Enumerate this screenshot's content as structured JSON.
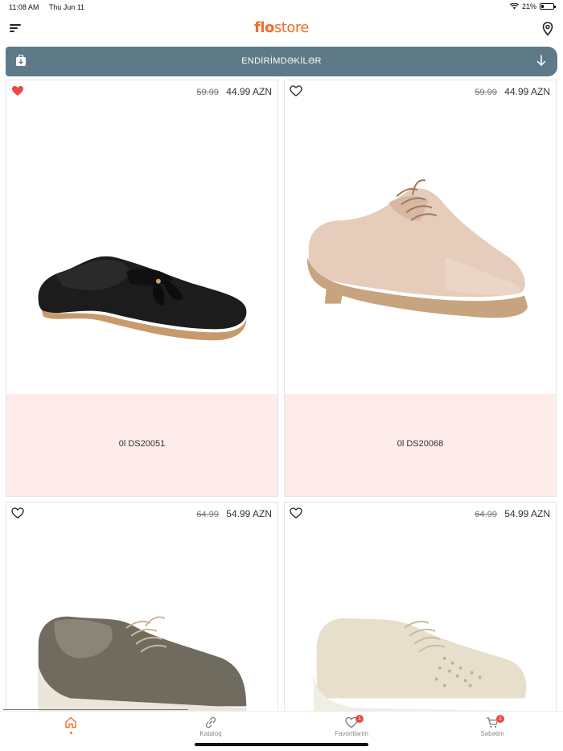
{
  "status_bar": {
    "time": "11:08 AM",
    "date": "Thu Jun 11",
    "battery": "21%",
    "battery_level": 0.21
  },
  "header": {
    "logo_bold": "flo",
    "logo_light": "store"
  },
  "banner": {
    "title": "ENDİRİMDƏKİLƏR"
  },
  "products": [
    {
      "name": "0l DS20051",
      "old_price": "59.99",
      "price": "44.99 AZN",
      "favorited": true,
      "image": "black-loafer"
    },
    {
      "name": "0l DS20068",
      "old_price": "59.99",
      "price": "44.99 AZN",
      "favorited": false,
      "image": "beige-oxford"
    },
    {
      "name": "",
      "old_price": "64.99",
      "price": "54.99 AZN",
      "favorited": false,
      "image": "metallic-oxford"
    },
    {
      "name": "",
      "old_price": "64.99",
      "price": "54.99 AZN",
      "favorited": false,
      "image": "cream-sneaker"
    }
  ],
  "bottom_nav": {
    "home": "",
    "catalog": "Kataloq",
    "favorites": "Favoritlərim",
    "favorites_badge": "1",
    "cart": "Səbətim",
    "cart_badge": "1"
  },
  "colors": {
    "accent": "#f36b2b",
    "banner": "#5e7a88",
    "card_label_bg": "#fdecea",
    "heart_active": "#e94b4b"
  }
}
